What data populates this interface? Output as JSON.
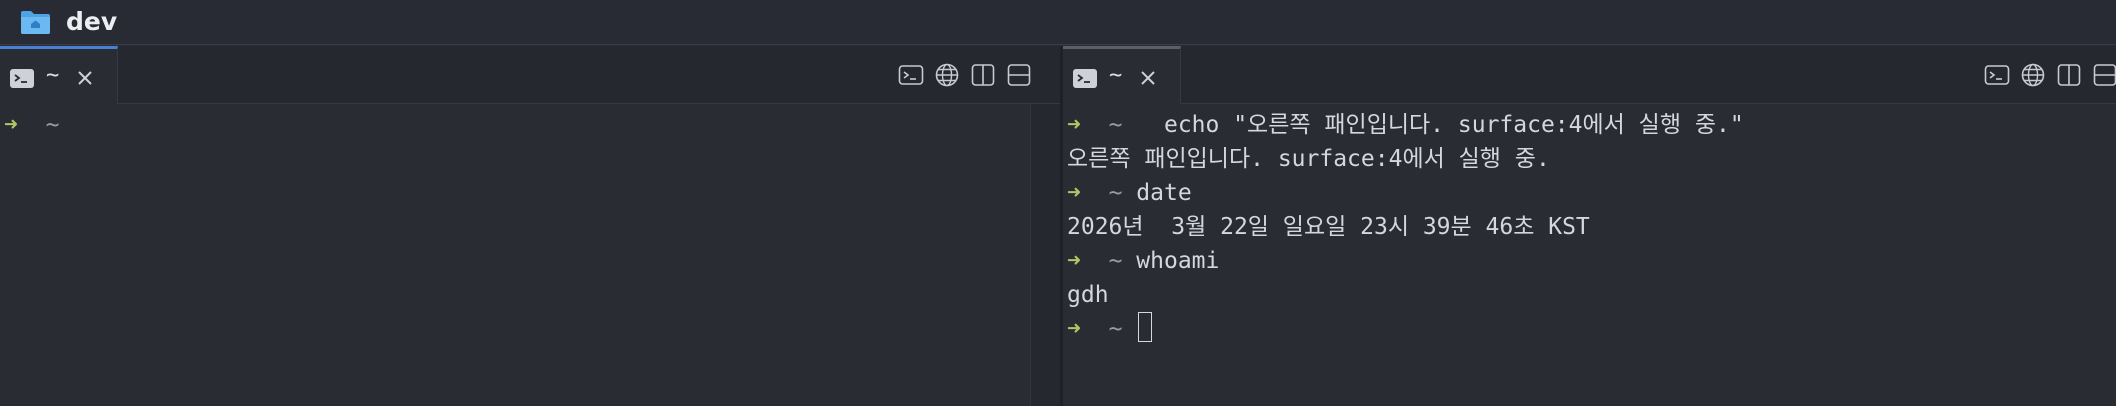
{
  "window": {
    "title": "dev",
    "folder_icon": "folder-home-icon"
  },
  "left_pane": {
    "tab": {
      "label": "~",
      "icon": "terminal-icon"
    },
    "toolbar_icons": [
      "terminal-icon",
      "globe-icon",
      "split-vertical-icon",
      "split-horizontal-icon"
    ],
    "lines": [
      {
        "prompt": "➜",
        "cwd": "~",
        "cmd": ""
      }
    ]
  },
  "right_pane": {
    "tab": {
      "label": "~",
      "icon": "terminal-icon"
    },
    "toolbar_icons": [
      "terminal-icon",
      "globe-icon",
      "split-vertical-icon",
      "split-horizontal-icon"
    ],
    "lines": [
      {
        "prompt": "➜",
        "cwd": "~",
        "cmd": " echo \"오른쪽 패인입니다. surface:4에서 실행 중.\""
      },
      {
        "output": "오른쪽 패인입니다. surface:4에서 실행 중."
      },
      {
        "prompt": "➜",
        "cwd": "~",
        "cmd": "date"
      },
      {
        "output": "2026년  3월 22일 일요일 23시 39분 46초 KST"
      },
      {
        "prompt": "➜",
        "cwd": "~",
        "cmd": "whoami"
      },
      {
        "output": "gdh"
      },
      {
        "prompt": "➜",
        "cwd": "~",
        "cmd": ""
      }
    ]
  },
  "colors": {
    "background": "#2a2c34",
    "prompt_arrow": "#b5c465",
    "active_tab_accent": "#4a7fd4"
  }
}
